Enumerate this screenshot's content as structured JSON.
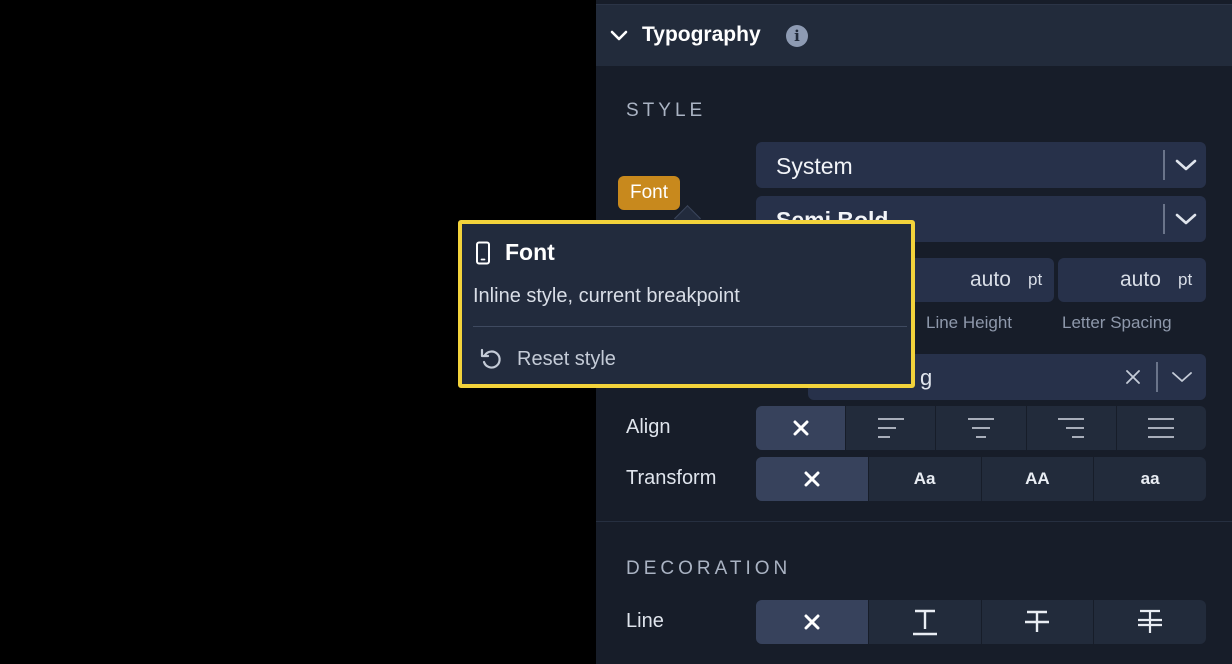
{
  "section": {
    "title": "Typography"
  },
  "style_group": {
    "heading": "STYLE",
    "font_chip": "Font",
    "font_family": "System",
    "font_weight": "Semi Bold",
    "line_height": {
      "value": "auto",
      "unit": "pt",
      "caption": "Line Height"
    },
    "letter_spacing": {
      "value": "auto",
      "unit": "pt",
      "caption": "Letter Spacing"
    },
    "combo_partial": "g",
    "align": {
      "label": "Align",
      "options": [
        "none",
        "left",
        "center",
        "right",
        "justify"
      ],
      "selected": "none"
    },
    "transform": {
      "label": "Transform",
      "options": [
        "none",
        "Aa",
        "AA",
        "aa"
      ],
      "selected": "none"
    }
  },
  "decoration_group": {
    "heading": "DECORATION",
    "line": {
      "label": "Line",
      "options": [
        "none",
        "underline",
        "strikethrough",
        "double-strike"
      ],
      "selected": "none"
    }
  },
  "tooltip": {
    "title": "Font",
    "description": "Inline style, current breakpoint",
    "reset_label": "Reset style",
    "icon": "mobile-device-icon",
    "border_color": "#f3d33b"
  },
  "colors": {
    "panel_bg": "#171d29",
    "header_bg": "#222b3b",
    "chip_bg": "#c8891d",
    "control_bg": "#27314a",
    "active_segment": "#37425c"
  }
}
